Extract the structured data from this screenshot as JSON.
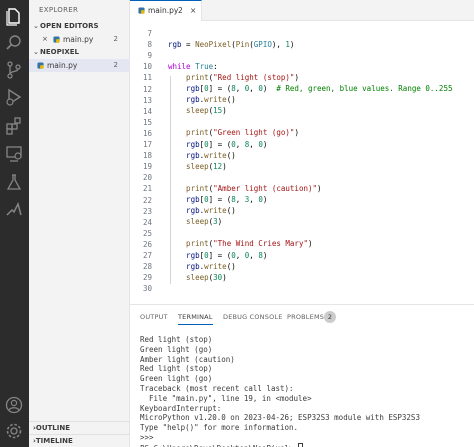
{
  "activity": [
    "explorer-icon",
    "search-icon",
    "source-control-icon",
    "run-debug-icon",
    "extensions-icon",
    "remote-explorer-icon",
    "testing-icon",
    "python-icon",
    "account-icon",
    "settings-gear-icon"
  ],
  "sidebar": {
    "title": "EXPLORER",
    "open_editors": "OPEN EDITORS",
    "open_file": {
      "close": "×",
      "name": "main.py",
      "count": "2"
    },
    "folder": "NEOPIXEL",
    "folder_file": {
      "name": "main.py",
      "count": "2"
    },
    "outline": "OUTLINE",
    "timeline": "TIMELINE"
  },
  "tab": {
    "name": "main.py",
    "count": "2",
    "close": "×"
  },
  "colors": {
    "activity_bg": "#2c2c2c",
    "accent": "#005fb8",
    "keyword": "#af00db",
    "function": "#795e26",
    "string": "#a31515",
    "number": "#098658"
  },
  "code": [
    {
      "n": "7"
    },
    {
      "n": "8",
      "t": [
        [
          "rgb",
          "var"
        ],
        [
          " = ",
          "pl"
        ],
        [
          "NeoPixel",
          "fn"
        ],
        [
          "(",
          "pl"
        ],
        [
          "Pin",
          "fn"
        ],
        [
          "(",
          "pl"
        ],
        [
          "GPIO",
          "cls"
        ],
        [
          "), ",
          "pl"
        ],
        [
          "1",
          "num"
        ],
        [
          ")",
          "pl"
        ]
      ]
    },
    {
      "n": "9"
    },
    {
      "n": "10",
      "t": [
        [
          "while",
          "kw"
        ],
        [
          " ",
          "pl"
        ],
        [
          "True",
          "cls"
        ],
        [
          ":",
          "pl"
        ]
      ]
    },
    {
      "n": "11",
      "t": [
        [
          "    print",
          "fn"
        ],
        [
          "(",
          "pl"
        ],
        [
          "\"Red light (stop)\"",
          "str"
        ],
        [
          ")",
          "pl"
        ]
      ]
    },
    {
      "n": "12",
      "t": [
        [
          "    rgb",
          "var"
        ],
        [
          "[",
          "pl"
        ],
        [
          "0",
          "num"
        ],
        [
          "] = (",
          "pl"
        ],
        [
          "8",
          "num"
        ],
        [
          ", ",
          "pl"
        ],
        [
          "0",
          "num"
        ],
        [
          ", ",
          "pl"
        ],
        [
          "0",
          "num"
        ],
        [
          ")  ",
          "pl"
        ],
        [
          "# Red, green, blue values. Range 0..255",
          "cm"
        ]
      ]
    },
    {
      "n": "13",
      "t": [
        [
          "    rgb",
          "var"
        ],
        [
          ".",
          "pl"
        ],
        [
          "write",
          "fn"
        ],
        [
          "()",
          "pl"
        ]
      ]
    },
    {
      "n": "14",
      "t": [
        [
          "    sleep",
          "fn"
        ],
        [
          "(",
          "pl"
        ],
        [
          "15",
          "num"
        ],
        [
          ")",
          "pl"
        ]
      ]
    },
    {
      "n": "15"
    },
    {
      "n": "16",
      "t": [
        [
          "    print",
          "fn"
        ],
        [
          "(",
          "pl"
        ],
        [
          "\"Green light (go)\"",
          "str"
        ],
        [
          ")",
          "pl"
        ]
      ]
    },
    {
      "n": "17",
      "t": [
        [
          "    rgb",
          "var"
        ],
        [
          "[",
          "pl"
        ],
        [
          "0",
          "num"
        ],
        [
          "] = (",
          "pl"
        ],
        [
          "0",
          "num"
        ],
        [
          ", ",
          "pl"
        ],
        [
          "8",
          "num"
        ],
        [
          ", ",
          "pl"
        ],
        [
          "0",
          "num"
        ],
        [
          ")",
          "pl"
        ]
      ]
    },
    {
      "n": "18",
      "t": [
        [
          "    rgb",
          "var"
        ],
        [
          ".",
          "pl"
        ],
        [
          "write",
          "fn"
        ],
        [
          "()",
          "pl"
        ]
      ]
    },
    {
      "n": "19",
      "t": [
        [
          "    sleep",
          "fn"
        ],
        [
          "(",
          "pl"
        ],
        [
          "12",
          "num"
        ],
        [
          ")",
          "pl"
        ]
      ]
    },
    {
      "n": "20"
    },
    {
      "n": "21",
      "t": [
        [
          "    print",
          "fn"
        ],
        [
          "(",
          "pl"
        ],
        [
          "\"Amber light (caution)\"",
          "str"
        ],
        [
          ")",
          "pl"
        ]
      ]
    },
    {
      "n": "22",
      "t": [
        [
          "    rgb",
          "var"
        ],
        [
          "[",
          "pl"
        ],
        [
          "0",
          "num"
        ],
        [
          "] = (",
          "pl"
        ],
        [
          "8",
          "num"
        ],
        [
          ", ",
          "pl"
        ],
        [
          "3",
          "num"
        ],
        [
          ", ",
          "pl"
        ],
        [
          "0",
          "num"
        ],
        [
          ")",
          "pl"
        ]
      ]
    },
    {
      "n": "23",
      "t": [
        [
          "    rgb",
          "var"
        ],
        [
          ".",
          "pl"
        ],
        [
          "write",
          "fn"
        ],
        [
          "()",
          "pl"
        ]
      ]
    },
    {
      "n": "24",
      "t": [
        [
          "    sleep",
          "fn"
        ],
        [
          "(",
          "pl"
        ],
        [
          "3",
          "num"
        ],
        [
          ")",
          "pl"
        ]
      ]
    },
    {
      "n": "25"
    },
    {
      "n": "26",
      "t": [
        [
          "    print",
          "fn"
        ],
        [
          "(",
          "pl"
        ],
        [
          "\"The Wind Cries Mary\"",
          "str"
        ],
        [
          ")",
          "pl"
        ]
      ]
    },
    {
      "n": "27",
      "t": [
        [
          "    rgb",
          "var"
        ],
        [
          "[",
          "pl"
        ],
        [
          "0",
          "num"
        ],
        [
          "] = (",
          "pl"
        ],
        [
          "0",
          "num"
        ],
        [
          ", ",
          "pl"
        ],
        [
          "0",
          "num"
        ],
        [
          ", ",
          "pl"
        ],
        [
          "8",
          "num"
        ],
        [
          ")",
          "pl"
        ]
      ]
    },
    {
      "n": "28",
      "t": [
        [
          "    rgb",
          "var"
        ],
        [
          ".",
          "pl"
        ],
        [
          "write",
          "fn"
        ],
        [
          "()",
          "pl"
        ]
      ]
    },
    {
      "n": "29",
      "t": [
        [
          "    sleep",
          "fn"
        ],
        [
          "(",
          "pl"
        ],
        [
          "30",
          "num"
        ],
        [
          ")",
          "pl"
        ]
      ]
    },
    {
      "n": "30"
    }
  ],
  "panel": {
    "tabs": [
      "OUTPUT",
      "TERMINAL",
      "DEBUG CONSOLE",
      "PROBLEMS"
    ],
    "problems_count": "2",
    "terminal": [
      "Red light (stop)",
      "Green light (go)",
      "Amber light (caution)",
      "Red light (stop)",
      "Green light (go)",
      "Traceback (most recent call last):",
      "  File \"main.py\", line 19, in <module>",
      "KeyboardInterrupt:",
      "MicroPython v1.20.0 on 2023-04-26; ESP32S3 module with ESP32S3",
      "Type \"help()\" for more information.",
      ">>> ",
      "PS C:\\Users\\Dave\\Desktop\\NeoPixel> "
    ]
  }
}
